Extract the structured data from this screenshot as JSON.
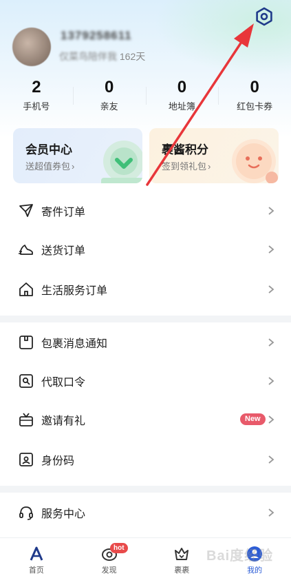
{
  "profile": {
    "username": "1379258611",
    "member_prefix": "仅菜鸟陪伴我",
    "member_days": "162天"
  },
  "stats": [
    {
      "value": "2",
      "label": "手机号"
    },
    {
      "value": "0",
      "label": "亲友"
    },
    {
      "value": "0",
      "label": "地址簿"
    },
    {
      "value": "0",
      "label": "红包卡券"
    }
  ],
  "cards": {
    "vip": {
      "title": "会员中心",
      "subtitle": "送超值券包"
    },
    "points": {
      "title": "裹酱积分",
      "subtitle": "签到领礼包"
    }
  },
  "menu_group_1": [
    {
      "label": "寄件订单",
      "icon": "send-plane-icon"
    },
    {
      "label": "送货订单",
      "icon": "delivery-shoe-icon"
    },
    {
      "label": "生活服务订单",
      "icon": "home-icon"
    }
  ],
  "menu_group_2": [
    {
      "label": "包裹消息通知",
      "icon": "package-notice-icon"
    },
    {
      "label": "代取口令",
      "icon": "pickup-code-icon"
    },
    {
      "label": "邀请有礼",
      "icon": "gift-tv-icon",
      "badge": "New"
    },
    {
      "label": "身份码",
      "icon": "id-code-icon"
    }
  ],
  "menu_group_3": [
    {
      "label": "服务中心",
      "icon": "headset-icon"
    }
  ],
  "tabbar": [
    {
      "label": "首页",
      "icon": "home-logo-icon"
    },
    {
      "label": "发现",
      "icon": "discover-icon",
      "badge": "hot"
    },
    {
      "label": "裹裹",
      "icon": "crown-box-icon"
    },
    {
      "label": "我的",
      "icon": "profile-icon",
      "active": true
    }
  ],
  "watermark": "Bai度经验",
  "colors": {
    "accent": "#2b5cd6",
    "new_badge": "#e85a6a",
    "arrow": "#e8363a"
  }
}
